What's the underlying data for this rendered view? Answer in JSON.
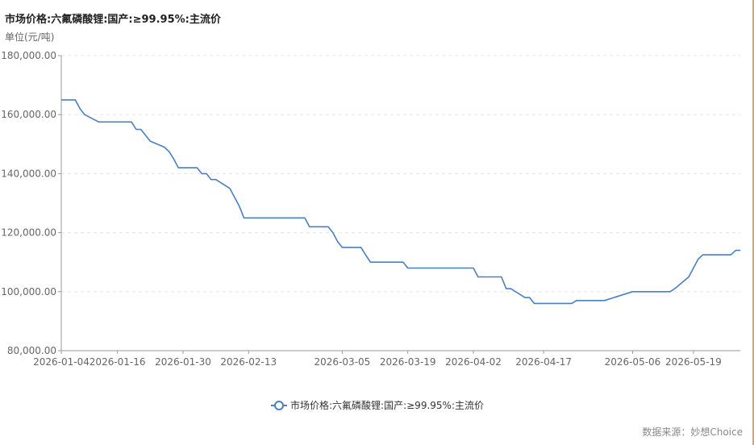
{
  "title": "市场价格:六氟磷酸锂:国产:≥99.95%:主流价",
  "unit_label": "单位(元/吨)",
  "source": "数据来源：妙想Choice",
  "colors": {
    "line": "#4a7fc0",
    "axis": "#999999",
    "grid": "#e6e6e6",
    "accent_border": "#e8a25a"
  },
  "chart_data": {
    "type": "line",
    "title": "市场价格:六氟磷酸锂:国产:≥99.95%:主流价",
    "ylabel": "单位(元/吨)",
    "xlabel": "",
    "ylim": [
      80000,
      180000
    ],
    "y_ticks": [
      "180,000.00",
      "160,000.00",
      "140,000.00",
      "120,000.00",
      "100,000.00",
      "80,000.00"
    ],
    "x_ticks": [
      "2026-01-04",
      "2026-01-16",
      "2026-01-30",
      "2026-02-13",
      "2026-03-05",
      "2026-03-19",
      "2026-04-02",
      "2026-04-17",
      "2026-05-06",
      "2026-05-19"
    ],
    "grid": true,
    "legend_position": "bottom-center",
    "series": [
      {
        "name": "市场价格:六氟磷酸锂:国产:≥99.95%:主流价",
        "points": [
          [
            "2026-01-04",
            165000
          ],
          [
            "2026-01-05",
            165000
          ],
          [
            "2026-01-06",
            165000
          ],
          [
            "2026-01-07",
            165000
          ],
          [
            "2026-01-08",
            162000
          ],
          [
            "2026-01-09",
            160000
          ],
          [
            "2026-01-12",
            157500
          ],
          [
            "2026-01-13",
            157500
          ],
          [
            "2026-01-14",
            157500
          ],
          [
            "2026-01-15",
            157500
          ],
          [
            "2026-01-16",
            157500
          ],
          [
            "2026-01-19",
            157500
          ],
          [
            "2026-01-20",
            155000
          ],
          [
            "2026-01-21",
            155000
          ],
          [
            "2026-01-22",
            153000
          ],
          [
            "2026-01-23",
            151000
          ],
          [
            "2026-01-26",
            149000
          ],
          [
            "2026-01-27",
            147500
          ],
          [
            "2026-01-28",
            145000
          ],
          [
            "2026-01-29",
            142000
          ],
          [
            "2026-01-30",
            142000
          ],
          [
            "2026-02-02",
            142000
          ],
          [
            "2026-02-03",
            140000
          ],
          [
            "2026-02-04",
            140000
          ],
          [
            "2026-02-05",
            138000
          ],
          [
            "2026-02-06",
            138000
          ],
          [
            "2026-02-09",
            135000
          ],
          [
            "2026-02-10",
            132000
          ],
          [
            "2026-02-11",
            129000
          ],
          [
            "2026-02-12",
            125000
          ],
          [
            "2026-02-13",
            125000
          ],
          [
            "2026-02-16",
            125000
          ],
          [
            "2026-02-17",
            125000
          ],
          [
            "2026-02-18",
            125000
          ],
          [
            "2026-02-19",
            125000
          ],
          [
            "2026-02-20",
            125000
          ],
          [
            "2026-02-23",
            125000
          ],
          [
            "2026-02-24",
            125000
          ],
          [
            "2026-02-25",
            125000
          ],
          [
            "2026-02-26",
            122000
          ],
          [
            "2026-02-27",
            122000
          ],
          [
            "2026-03-02",
            122000
          ],
          [
            "2026-03-03",
            120000
          ],
          [
            "2026-03-04",
            117000
          ],
          [
            "2026-03-05",
            115000
          ],
          [
            "2026-03-06",
            115000
          ],
          [
            "2026-03-09",
            115000
          ],
          [
            "2026-03-10",
            112500
          ],
          [
            "2026-03-11",
            110000
          ],
          [
            "2026-03-12",
            110000
          ],
          [
            "2026-03-13",
            110000
          ],
          [
            "2026-03-16",
            110000
          ],
          [
            "2026-03-17",
            110000
          ],
          [
            "2026-03-18",
            110000
          ],
          [
            "2026-03-19",
            108000
          ],
          [
            "2026-03-20",
            108000
          ],
          [
            "2026-03-23",
            108000
          ],
          [
            "2026-03-24",
            108000
          ],
          [
            "2026-03-25",
            108000
          ],
          [
            "2026-03-26",
            108000
          ],
          [
            "2026-03-27",
            108000
          ],
          [
            "2026-03-30",
            108000
          ],
          [
            "2026-03-31",
            108000
          ],
          [
            "2026-04-01",
            108000
          ],
          [
            "2026-04-02",
            108000
          ],
          [
            "2026-04-03",
            105000
          ],
          [
            "2026-04-07",
            105000
          ],
          [
            "2026-04-08",
            105000
          ],
          [
            "2026-04-09",
            101000
          ],
          [
            "2026-04-10",
            101000
          ],
          [
            "2026-04-13",
            98000
          ],
          [
            "2026-04-14",
            98000
          ],
          [
            "2026-04-15",
            96000
          ],
          [
            "2026-04-16",
            96000
          ],
          [
            "2026-04-17",
            96000
          ],
          [
            "2026-04-20",
            96000
          ],
          [
            "2026-04-21",
            96000
          ],
          [
            "2026-04-22",
            96000
          ],
          [
            "2026-04-23",
            96000
          ],
          [
            "2026-04-24",
            97000
          ],
          [
            "2026-04-27",
            97000
          ],
          [
            "2026-04-28",
            97000
          ],
          [
            "2026-04-29",
            97000
          ],
          [
            "2026-04-30",
            97000
          ],
          [
            "2026-05-06",
            100000
          ],
          [
            "2026-05-07",
            100000
          ],
          [
            "2026-05-08",
            100000
          ],
          [
            "2026-05-11",
            100000
          ],
          [
            "2026-05-12",
            100000
          ],
          [
            "2026-05-13",
            100000
          ],
          [
            "2026-05-14",
            100000
          ],
          [
            "2026-05-15",
            101000
          ],
          [
            "2026-05-18",
            105000
          ],
          [
            "2026-05-19",
            108000
          ],
          [
            "2026-05-20",
            111000
          ],
          [
            "2026-05-21",
            112500
          ],
          [
            "2026-05-22",
            112500
          ],
          [
            "2026-05-25",
            112500
          ],
          [
            "2026-05-26",
            112500
          ],
          [
            "2026-05-27",
            112500
          ],
          [
            "2026-05-28",
            114000
          ],
          [
            "2026-05-29",
            114000
          ]
        ]
      }
    ]
  }
}
